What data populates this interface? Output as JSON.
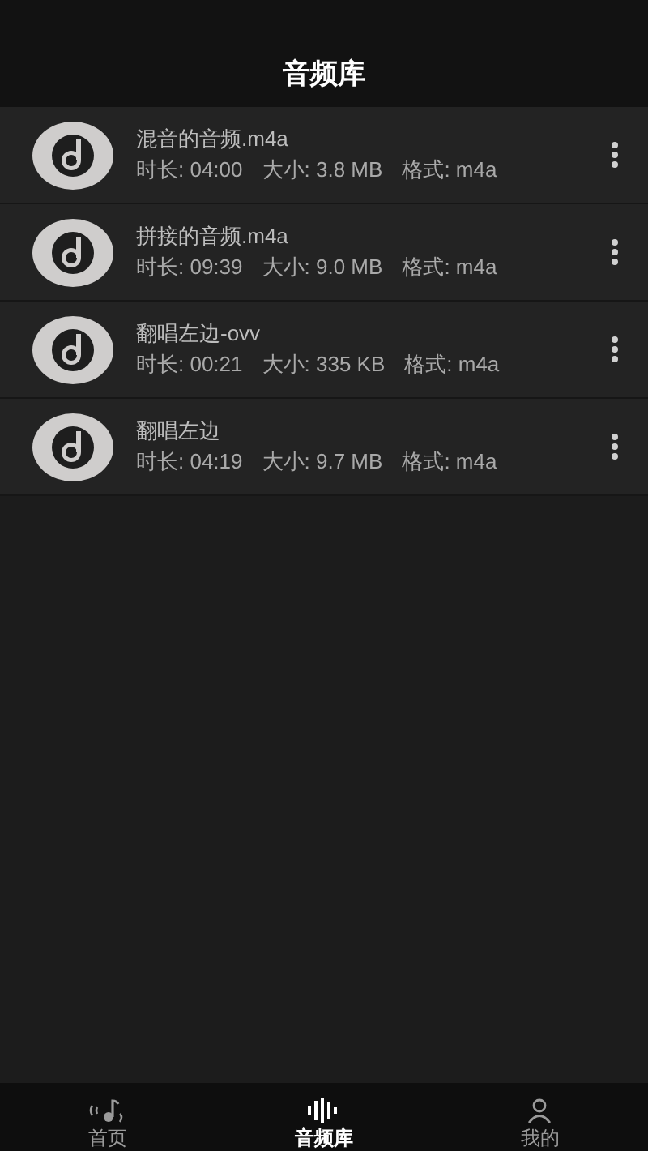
{
  "header": {
    "title": "音频库"
  },
  "files": [
    {
      "name": "混音的音频.m4a",
      "duration": "时长: 04:00",
      "size": "大小: 3.8 MB",
      "format": "格式: m4a"
    },
    {
      "name": "拼接的音频.m4a",
      "duration": "时长: 09:39",
      "size": "大小: 9.0 MB",
      "format": "格式: m4a"
    },
    {
      "name": "翻唱左边-ovv",
      "duration": "时长: 00:21",
      "size": "大小: 335 KB",
      "format": "格式: m4a"
    },
    {
      "name": "翻唱左边",
      "duration": "时长: 04:19",
      "size": "大小: 9.7 MB",
      "format": "格式: m4a"
    }
  ],
  "tabs": [
    {
      "kind": "home",
      "label": "首页",
      "selected": false
    },
    {
      "kind": "library",
      "label": "音频库",
      "selected": true
    },
    {
      "kind": "me",
      "label": "我的",
      "selected": false
    }
  ]
}
